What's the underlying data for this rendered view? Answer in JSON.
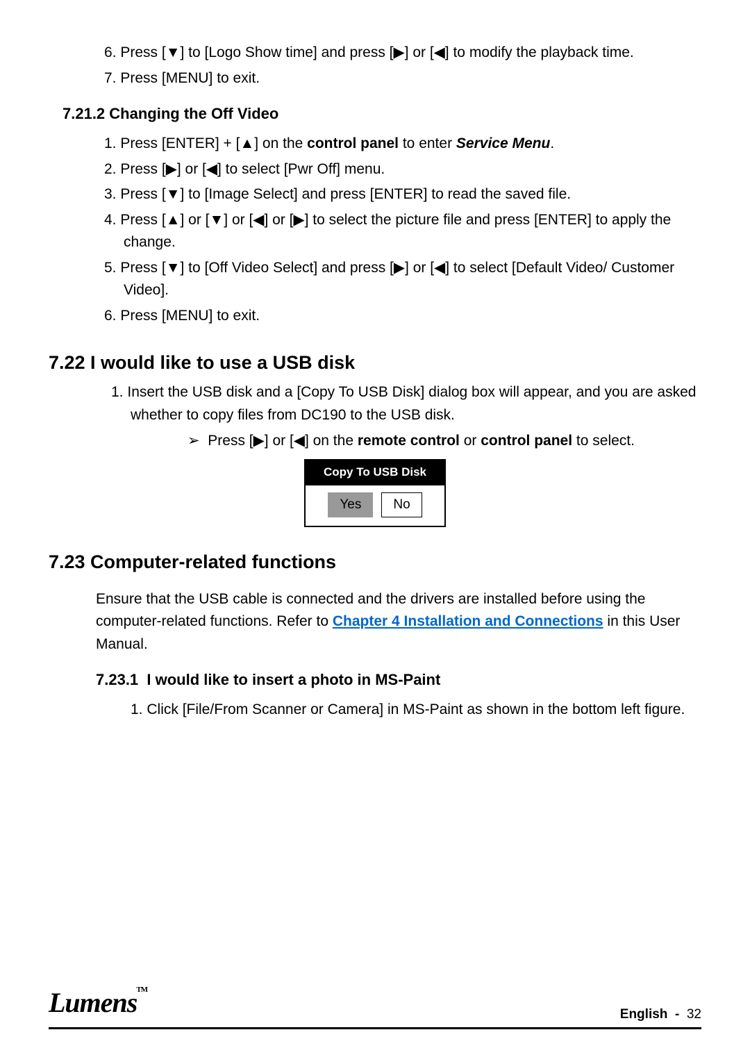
{
  "cont_list": {
    "i6_num": "6.",
    "i6": "Press [▼] to [Logo Show time] and press [▶] or [◀] to modify the playback time.",
    "i7_num": "7.",
    "i7": "Press [MENU] to exit."
  },
  "sec_7212": {
    "heading_num": "7.21.2",
    "heading": "Changing the Off Video",
    "s1_num": "1.",
    "s1a": "Press [ENTER] + [▲] on the ",
    "s1b": "control panel",
    "s1c": " to enter ",
    "s1d": "Service Menu",
    "s1e": ".",
    "s2_num": "2.",
    "s2": "Press [▶] or [◀] to select [Pwr Off] menu.",
    "s3_num": "3.",
    "s3": "Press [▼] to [Image Select] and press [ENTER] to read the saved file.",
    "s4_num": "4.",
    "s4": "Press [▲] or [▼] or [◀] or [▶] to select the picture file and press [ENTER] to apply the change.",
    "s5_num": "5.",
    "s5": "Press [▼] to [Off Video Select] and press [▶] or [◀] to select [Default Video/ Customer Video].",
    "s6_num": "6.",
    "s6": "Press [MENU] to exit."
  },
  "sec_722": {
    "heading": "7.22 I would like to use a USB disk",
    "i1_num": "1.",
    "i1": "Insert the USB disk and a [Copy To USB Disk] dialog box will appear, and you are asked whether to copy files from DC190 to the USB disk.",
    "sub_arrow": "➢",
    "sub_a": "Press [▶] or [◀] on the ",
    "sub_b": "remote control",
    "sub_c": " or ",
    "sub_d": "control panel",
    "sub_e": " to select.",
    "dialog_title": "Copy To USB Disk",
    "yes": "Yes",
    "no": "No"
  },
  "sec_723": {
    "heading": "7.23 Computer-related functions",
    "para_a": "Ensure that the USB cable is connected and the drivers are installed before using the computer-related functions. Refer to ",
    "link": "Chapter 4 Installation and Connections",
    "para_b": " in this User Manual."
  },
  "sec_7231": {
    "heading_num": "7.23.1",
    "heading": "I would like to insert a photo in MS-Paint",
    "i1_num": "1.",
    "i1": "Click [File/From Scanner or Camera] in MS-Paint as shown in the bottom left figure."
  },
  "footer": {
    "logo": "Lumens",
    "tm": "TM",
    "lang": "English",
    "sep": "-",
    "page": "32"
  }
}
